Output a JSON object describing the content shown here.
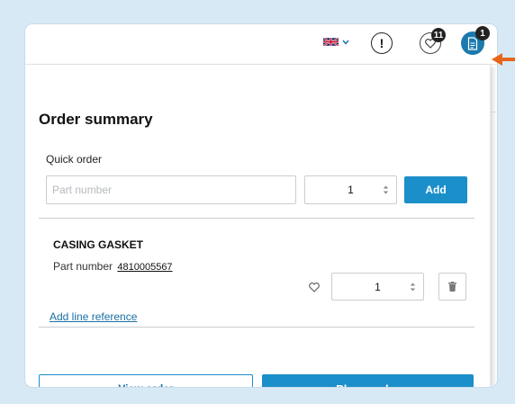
{
  "header": {
    "language_icon": "uk-flag-icon",
    "chevron_icon": "chevron-down-icon",
    "alert_label": "!",
    "favorites_count": "11",
    "cart_count": "1"
  },
  "order_summary": {
    "title": "Order summary",
    "quick_order": {
      "label": "Quick order",
      "part_number_placeholder": "Part number",
      "quantity": "1",
      "add_label": "Add"
    },
    "items": [
      {
        "name": "CASING GASKET",
        "part_number_label": "Part number",
        "part_number": "4810005567",
        "quantity": "1"
      }
    ],
    "add_line_reference": "Add line reference",
    "view_order_label": "View order",
    "place_order_label": "Place order"
  },
  "colors": {
    "primary": "#1b8fc9",
    "link": "#1b6fa6",
    "annotation_arrow": "#e8661c",
    "background": "#d8e9f6"
  }
}
